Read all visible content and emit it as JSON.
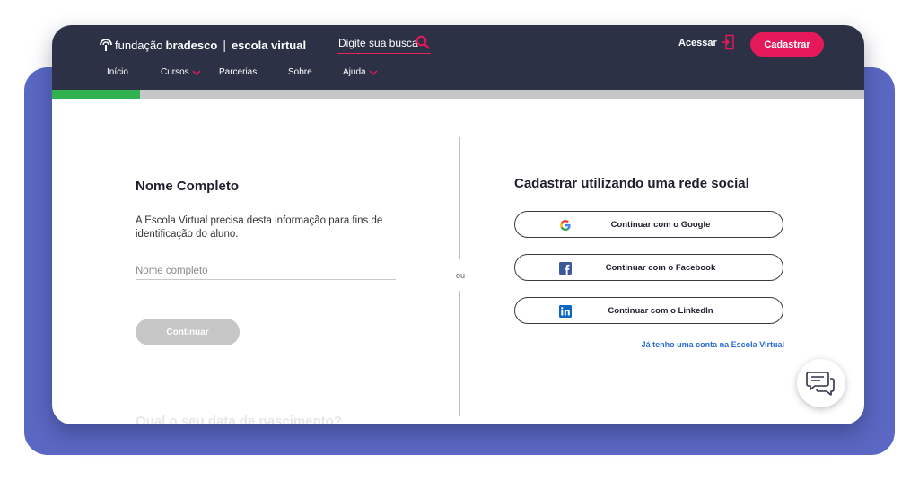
{
  "header": {
    "logo": {
      "fundacao": "fundação",
      "bradesco": "bradesco",
      "separator": "|",
      "escola": "escola virtual"
    },
    "search": {
      "text": "Digite sua busca"
    },
    "login_label": "Acessar",
    "signup_label": "Cadastrar",
    "colors": {
      "bar": "#2d3146",
      "accent": "#e5195a"
    }
  },
  "nav": {
    "items": [
      {
        "label": "Início",
        "dropdown": false
      },
      {
        "label": "Cursos",
        "dropdown": true
      },
      {
        "label": "Parcerias",
        "dropdown": false
      },
      {
        "label": "Sobre",
        "dropdown": false
      },
      {
        "label": "Ajuda",
        "dropdown": true
      }
    ]
  },
  "progress": {
    "fraction": 0.108,
    "color": "#2fb24f"
  },
  "form": {
    "title": "Nome Completo",
    "description": "A Escola Virtual precisa desta informação para fins de identificação do aluno.",
    "name_input": {
      "value": "",
      "placeholder": "Nome completo"
    },
    "continue_label": "Continuar",
    "next_title_faded": "Qual o seu data de nascimento?"
  },
  "divider": {
    "or_label": "ou"
  },
  "social": {
    "title": "Cadastrar utilizando uma rede social",
    "buttons": [
      {
        "label": "Continuar com o Google",
        "icon": "google-icon"
      },
      {
        "label": "Continuar com o Facebook",
        "icon": "facebook-icon"
      },
      {
        "label": "Continuar com o LinkedIn",
        "icon": "linkedin-icon"
      }
    ],
    "have_account_label": "Já tenho uma conta na Escola Virtual"
  },
  "chat": {
    "icon": "chat-icon"
  }
}
